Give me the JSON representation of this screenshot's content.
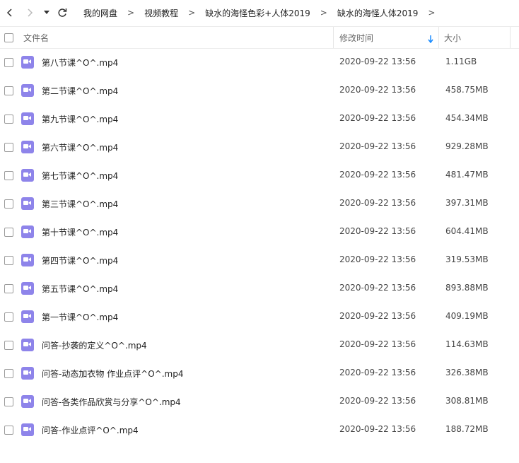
{
  "nav": {
    "breadcrumbs": [
      "我的网盘",
      "视频教程",
      "缺水的海怪色彩+人体2019",
      "缺水的海怪人体2019"
    ],
    "separator": ">"
  },
  "table": {
    "columns": {
      "name": "文件名",
      "modified": "修改时间",
      "size": "大小"
    },
    "sort": {
      "column": "modified",
      "direction": "down"
    }
  },
  "files": [
    {
      "name": "第八节课^O^.mp4",
      "modified": "2020-09-22 13:56",
      "size": "1.11GB"
    },
    {
      "name": "第二节课^O^.mp4",
      "modified": "2020-09-22 13:56",
      "size": "458.75MB"
    },
    {
      "name": "第九节课^O^.mp4",
      "modified": "2020-09-22 13:56",
      "size": "454.34MB"
    },
    {
      "name": "第六节课^O^.mp4",
      "modified": "2020-09-22 13:56",
      "size": "929.28MB"
    },
    {
      "name": "第七节课^O^.mp4",
      "modified": "2020-09-22 13:56",
      "size": "481.47MB"
    },
    {
      "name": "第三节课^O^.mp4",
      "modified": "2020-09-22 13:56",
      "size": "397.31MB"
    },
    {
      "name": "第十节课^O^.mp4",
      "modified": "2020-09-22 13:56",
      "size": "604.41MB"
    },
    {
      "name": "第四节课^O^.mp4",
      "modified": "2020-09-22 13:56",
      "size": "319.53MB"
    },
    {
      "name": "第五节课^O^.mp4",
      "modified": "2020-09-22 13:56",
      "size": "893.88MB"
    },
    {
      "name": "第一节课^O^.mp4",
      "modified": "2020-09-22 13:56",
      "size": "409.19MB"
    },
    {
      "name": "问答-抄袭的定义^O^.mp4",
      "modified": "2020-09-22 13:56",
      "size": "114.63MB"
    },
    {
      "name": "问答-动态加衣物 作业点评^O^.mp4",
      "modified": "2020-09-22 13:56",
      "size": "326.38MB"
    },
    {
      "name": "问答-各类作品欣赏与分享^O^.mp4",
      "modified": "2020-09-22 13:56",
      "size": "308.81MB"
    },
    {
      "name": "问答-作业点评^O^.mp4",
      "modified": "2020-09-22 13:56",
      "size": "188.72MB"
    }
  ],
  "colors": {
    "video_icon": "#8e84ea",
    "sort_arrow": "#1a8cff",
    "border": "#ececec"
  },
  "icons": {
    "back": "chevron-left-icon",
    "forward": "chevron-right-icon",
    "history": "caret-down-icon",
    "refresh": "refresh-icon",
    "file_type": "video-file-icon",
    "sort": "arrow-down-icon"
  }
}
